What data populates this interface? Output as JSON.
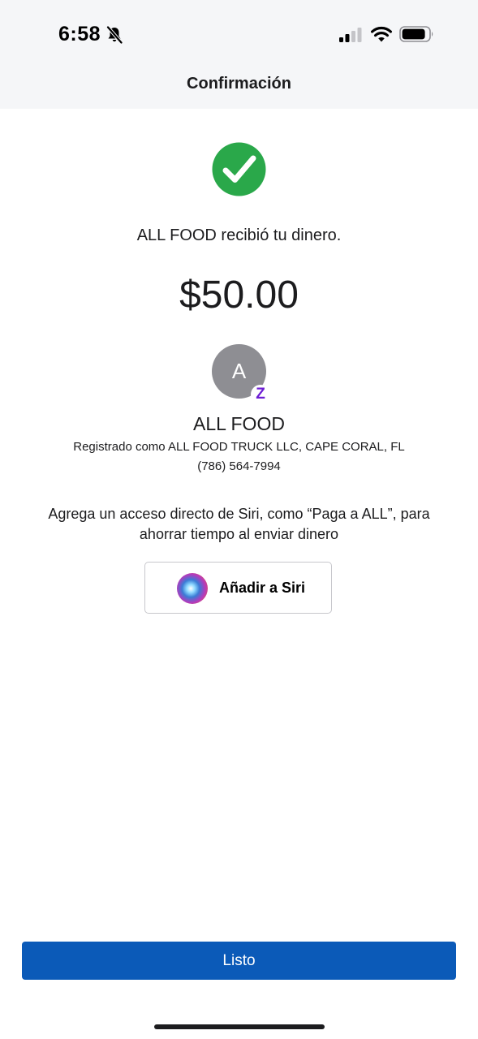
{
  "status_bar": {
    "time": "6:58",
    "icons": [
      "bell-slash-icon",
      "cellular-signal-icon",
      "wifi-icon",
      "battery-icon"
    ]
  },
  "nav": {
    "title": "Confirmación"
  },
  "confirmation": {
    "icon": "checkmark-circle-icon",
    "message": "ALL FOOD recibió tu dinero.",
    "amount": "$50.00"
  },
  "recipient": {
    "avatar_initial": "A",
    "badge": "Z",
    "badge_icon": "zelle-icon",
    "name": "ALL FOOD",
    "registered_as": "Registrado como ALL FOOD TRUCK LLC, CAPE CORAL, FL",
    "phone": "(786) 564-7994"
  },
  "siri": {
    "prompt": "Agrega un acceso directo de Siri, como “Paga a ALL”, para ahorrar tiempo al enviar dinero",
    "button_label": "Añadir a Siri",
    "icon": "siri-icon"
  },
  "footer": {
    "done_label": "Listo"
  },
  "colors": {
    "primary_button": "#0b5ab8",
    "success": "#2aa84a",
    "zelle": "#6d1ed4",
    "avatar_bg": "#8e8e93"
  }
}
